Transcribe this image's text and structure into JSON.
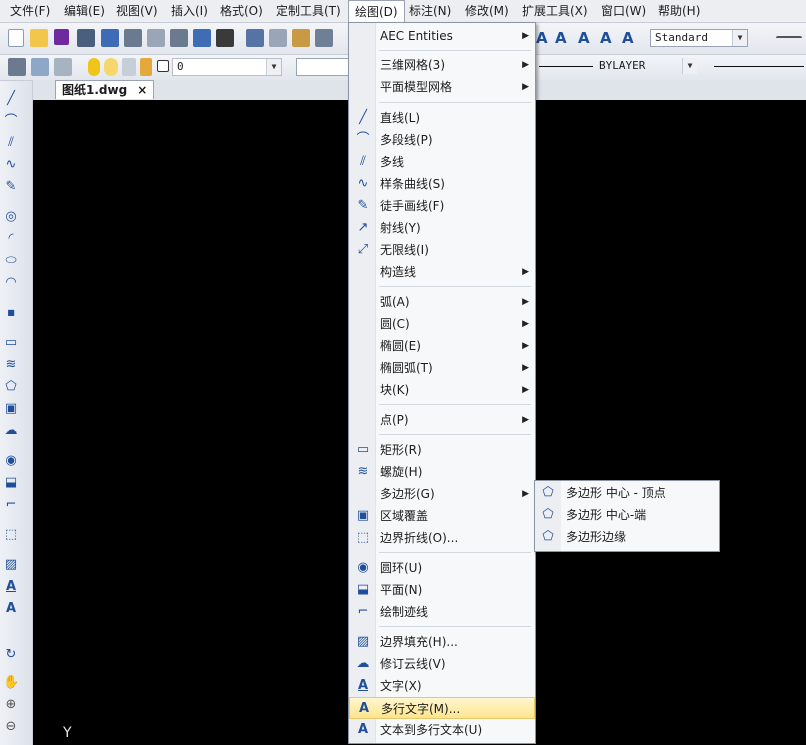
{
  "menubar": [
    "文件(F)",
    "编辑(E)",
    "视图(V)",
    "插入(I)",
    "格式(O)",
    "定制工具(T)",
    "绘图(D)",
    "标注(N)",
    "修改(M)",
    "扩展工具(X)",
    "窗口(W)",
    "帮助(H)"
  ],
  "toolbar": {
    "text_style": "Standard",
    "layer_value": "0",
    "linetype": "BYLAYER"
  },
  "tab": {
    "title": "图纸1.dwg",
    "close": "×"
  },
  "canvas": {
    "axis_y": "Y"
  },
  "draw_menu": [
    {
      "label": "AEC Entities",
      "icon": "",
      "sub": "▶"
    },
    {
      "label": "三维网格(3)",
      "icon": "",
      "sub": "▶"
    },
    {
      "label": "平面模型网格",
      "icon": "",
      "sub": "▶"
    },
    {
      "label": "直线(L)",
      "icon": "line-icon",
      "sub": ""
    },
    {
      "label": "多段线(P)",
      "icon": "polyline-icon",
      "sub": ""
    },
    {
      "label": "多线",
      "icon": "multiline-icon",
      "sub": ""
    },
    {
      "label": "样条曲线(S)",
      "icon": "spline-icon",
      "sub": ""
    },
    {
      "label": "徒手画线(F)",
      "icon": "freehand-icon",
      "sub": ""
    },
    {
      "label": "射线(Y)",
      "icon": "ray-icon",
      "sub": ""
    },
    {
      "label": "无限线(I)",
      "icon": "xline-icon",
      "sub": ""
    },
    {
      "label": "构造线",
      "icon": "",
      "sub": "▶"
    },
    {
      "label": "弧(A)",
      "icon": "",
      "sub": "▶"
    },
    {
      "label": "圆(C)",
      "icon": "",
      "sub": "▶"
    },
    {
      "label": "椭圆(E)",
      "icon": "",
      "sub": "▶"
    },
    {
      "label": "椭圆弧(T)",
      "icon": "",
      "sub": "▶"
    },
    {
      "label": "块(K)",
      "icon": "",
      "sub": "▶"
    },
    {
      "label": "点(P)",
      "icon": "",
      "sub": "▶"
    },
    {
      "label": "矩形(R)",
      "icon": "rectangle-icon",
      "sub": ""
    },
    {
      "label": "螺旋(H)",
      "icon": "helix-icon",
      "sub": ""
    },
    {
      "label": "多边形(G)",
      "icon": "",
      "sub": "▶"
    },
    {
      "label": "区域覆盖",
      "icon": "wipeout-icon",
      "sub": ""
    },
    {
      "label": "边界折线(O)...",
      "icon": "boundary-icon",
      "sub": ""
    },
    {
      "label": "圆环(U)",
      "icon": "donut-icon",
      "sub": ""
    },
    {
      "label": "平面(N)",
      "icon": "plane-icon",
      "sub": ""
    },
    {
      "label": "绘制迹线",
      "icon": "trace-icon",
      "sub": ""
    },
    {
      "label": "边界填充(H)...",
      "icon": "hatch-icon",
      "sub": ""
    },
    {
      "label": "修订云线(V)",
      "icon": "revcloud-icon",
      "sub": ""
    },
    {
      "label": "文字(X)",
      "icon": "text-icon",
      "sub": ""
    },
    {
      "label": "多行文字(M)...",
      "icon": "mtext-icon",
      "sub": ""
    },
    {
      "label": "文本到多行文本(U)",
      "icon": "text-to-mtext-icon",
      "sub": ""
    }
  ],
  "polygon_submenu": [
    {
      "label": "多边形 中心 - 顶点"
    },
    {
      "label": "多边形 中心-端"
    },
    {
      "label": "多边形边缘"
    }
  ]
}
